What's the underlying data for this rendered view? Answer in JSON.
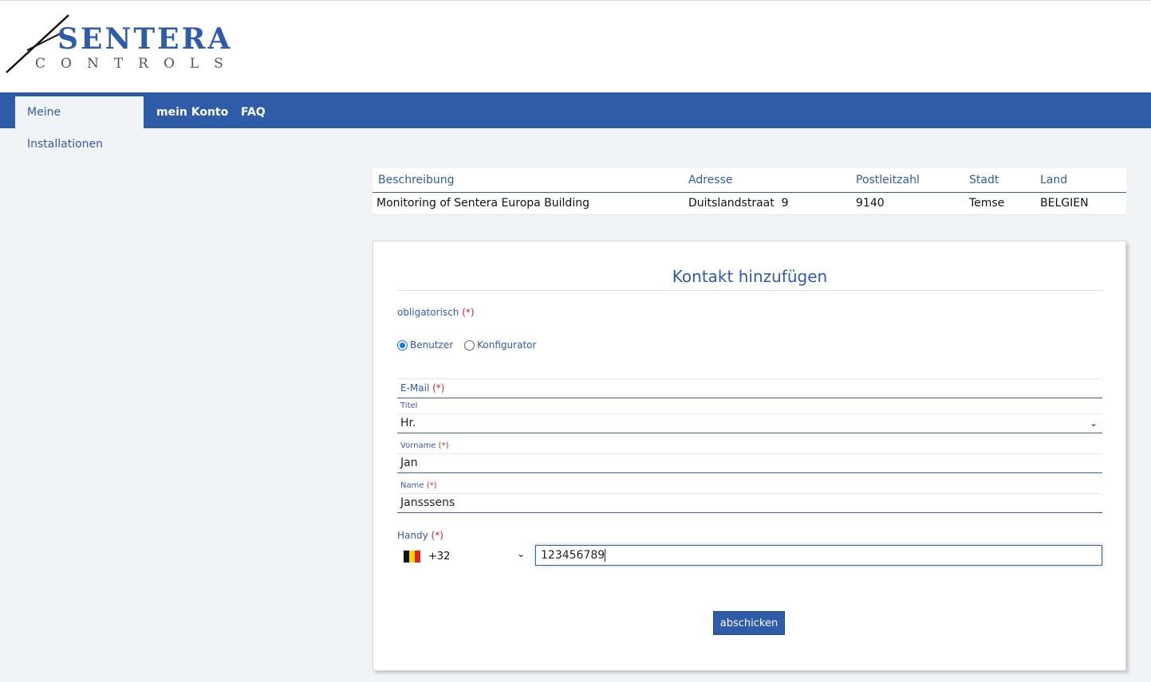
{
  "logo": {
    "word1": "SENTERA",
    "word2": "CONTROLS"
  },
  "nav": {
    "tabs": [
      {
        "label": "Meine Installationen"
      },
      {
        "label": "mein Konto"
      },
      {
        "label": "FAQ"
      }
    ]
  },
  "installation_table": {
    "headers": [
      "Beschreibung",
      "Adresse",
      "Postleitzahl",
      "Stadt",
      "Land"
    ],
    "rows": [
      [
        "Monitoring of Sentera Europa Building",
        "Duitslandstraat  9",
        "9140",
        "Temse",
        "BELGIEN"
      ]
    ]
  },
  "form": {
    "title": "Kontakt hinzufügen",
    "required_note": "obligatorisch",
    "required_mark": "(*)",
    "radio": [
      {
        "label": "Benutzer",
        "checked": true
      },
      {
        "label": "Konfigurator",
        "checked": false
      }
    ],
    "email": {
      "label": "E-Mail",
      "value": ""
    },
    "title_field": {
      "label": "Titel",
      "value": "Hr."
    },
    "firstname": {
      "label": "Vorname",
      "value": "Jan"
    },
    "lastname": {
      "label": "Name",
      "value": "Jansssens"
    },
    "phone": {
      "label": "Handy",
      "country_code": "+32",
      "value": "123456789"
    },
    "submit_label": "abschicken"
  },
  "colors": {
    "brand": "#2f5ca8",
    "required": "#c0272d"
  }
}
